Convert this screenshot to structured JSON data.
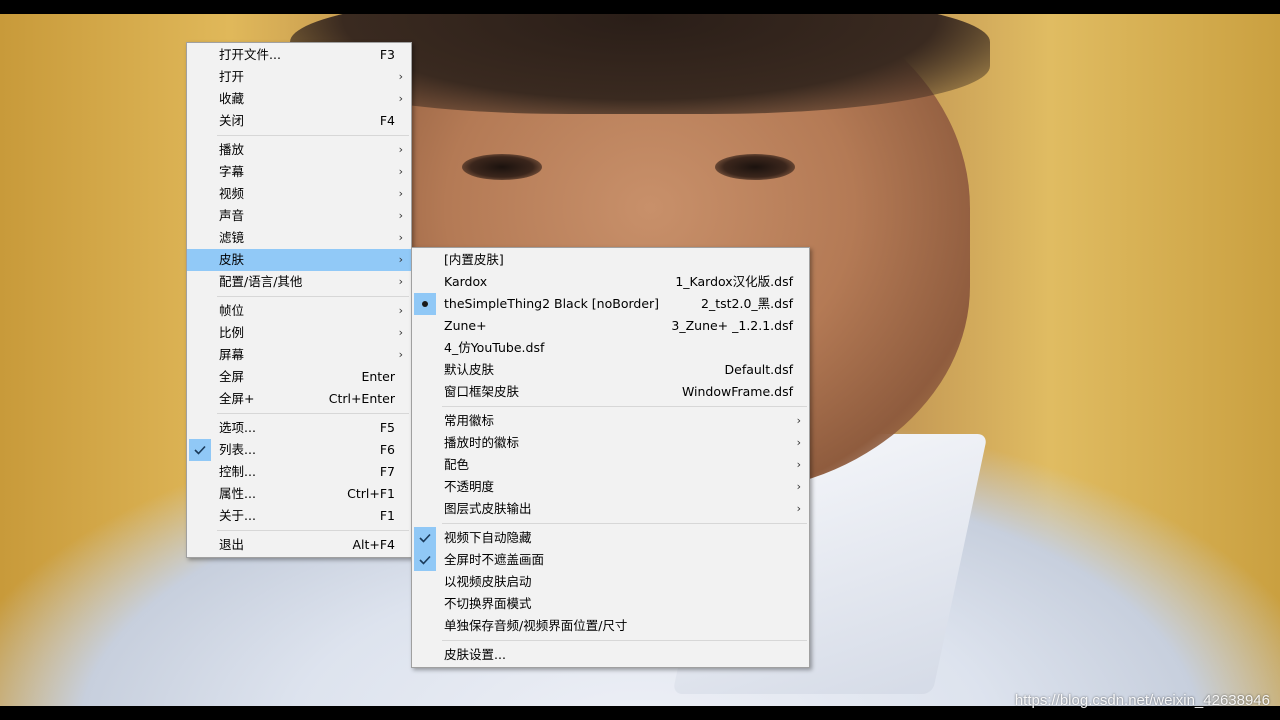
{
  "main_menu": {
    "items": [
      {
        "label": "打开文件...",
        "accel": "F3",
        "arrow": false
      },
      {
        "label": "打开",
        "accel": "",
        "arrow": true
      },
      {
        "label": "收藏",
        "accel": "",
        "arrow": true
      },
      {
        "label": "关闭",
        "accel": "F4",
        "arrow": false
      },
      {
        "label": "播放",
        "accel": "",
        "arrow": true
      },
      {
        "label": "字幕",
        "accel": "",
        "arrow": true
      },
      {
        "label": "视频",
        "accel": "",
        "arrow": true
      },
      {
        "label": "声音",
        "accel": "",
        "arrow": true
      },
      {
        "label": "滤镜",
        "accel": "",
        "arrow": true
      },
      {
        "label": "皮肤",
        "accel": "",
        "arrow": true,
        "highlighted": true
      },
      {
        "label": "配置/语言/其他",
        "accel": "",
        "arrow": true
      },
      {
        "label": "帧位",
        "accel": "",
        "arrow": true
      },
      {
        "label": "比例",
        "accel": "",
        "arrow": true
      },
      {
        "label": "屏幕",
        "accel": "",
        "arrow": true
      },
      {
        "label": "全屏",
        "accel": "Enter",
        "arrow": false
      },
      {
        "label": "全屏+",
        "accel": "Ctrl+Enter",
        "arrow": false
      },
      {
        "label": "选项...",
        "accel": "F5",
        "arrow": false
      },
      {
        "label": "列表...",
        "accel": "F6",
        "arrow": false,
        "checked": true
      },
      {
        "label": "控制...",
        "accel": "F7",
        "arrow": false
      },
      {
        "label": "属性...",
        "accel": "Ctrl+F1",
        "arrow": false
      },
      {
        "label": "关于...",
        "accel": "F1",
        "arrow": false
      },
      {
        "label": "退出",
        "accel": "Alt+F4",
        "arrow": false
      }
    ]
  },
  "skin_menu": {
    "items": [
      {
        "label": "[内置皮肤]",
        "accel": "",
        "arrow": false
      },
      {
        "label": "Kardox",
        "accel": "1_Kardox汉化版.dsf",
        "arrow": false
      },
      {
        "label": "theSimpleThing2 Black [noBorder]",
        "accel": "2_tst2.0_黑.dsf",
        "arrow": false,
        "radio": true
      },
      {
        "label": "Zune+",
        "accel": "3_Zune+ _1.2.1.dsf",
        "arrow": false
      },
      {
        "label": "4_仿YouTube.dsf",
        "accel": "",
        "arrow": false
      },
      {
        "label": "默认皮肤",
        "accel": "Default.dsf",
        "arrow": false
      },
      {
        "label": "窗口框架皮肤",
        "accel": "WindowFrame.dsf",
        "arrow": false
      },
      {
        "label": "常用徽标",
        "accel": "",
        "arrow": true
      },
      {
        "label": "播放时的徽标",
        "accel": "",
        "arrow": true
      },
      {
        "label": "配色",
        "accel": "",
        "arrow": true
      },
      {
        "label": "不透明度",
        "accel": "",
        "arrow": true
      },
      {
        "label": "图层式皮肤输出",
        "accel": "",
        "arrow": true
      },
      {
        "label": "视频下自动隐藏",
        "accel": "",
        "arrow": false,
        "checked": true
      },
      {
        "label": "全屏时不遮盖画面",
        "accel": "",
        "arrow": false,
        "checked": true
      },
      {
        "label": "以视频皮肤启动",
        "accel": "",
        "arrow": false
      },
      {
        "label": "不切换界面模式",
        "accel": "",
        "arrow": false
      },
      {
        "label": "单独保存音频/视频界面位置/尺寸",
        "accel": "",
        "arrow": false
      },
      {
        "label": "皮肤设置...",
        "accel": "",
        "arrow": false
      }
    ]
  },
  "watermark": "https://blog.csdn.net/weixin_42638946",
  "icons": {
    "check": "check-icon",
    "radio": "radio-dot-icon",
    "submenu": "chevron-right-icon"
  },
  "colors": {
    "highlight": "#91c9f7",
    "menu_bg": "#f2f2f2"
  }
}
